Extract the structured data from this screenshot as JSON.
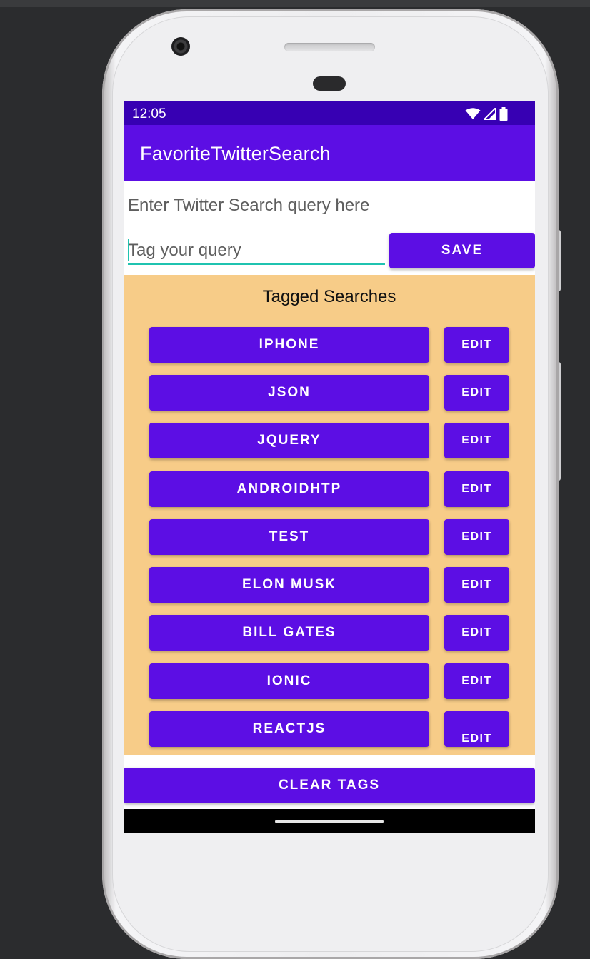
{
  "status_bar": {
    "time": "12:05",
    "icons": [
      "wifi-icon",
      "signal-icon",
      "battery-icon"
    ]
  },
  "app_bar": {
    "title": "FavoriteTwitterSearch"
  },
  "form": {
    "query_placeholder": "Enter Twitter Search query here",
    "query_value": "",
    "tag_placeholder": "Tag your query",
    "tag_value": "",
    "save_label": "SAVE"
  },
  "tagged": {
    "title": "Tagged Searches",
    "items": [
      {
        "label": "IPHONE",
        "edit": "EDIT"
      },
      {
        "label": "JSON",
        "edit": "EDIT"
      },
      {
        "label": "JQUERY",
        "edit": "EDIT"
      },
      {
        "label": "ANDROIDHTP",
        "edit": "EDIT"
      },
      {
        "label": "TEST",
        "edit": "EDIT"
      },
      {
        "label": "ELON MUSK",
        "edit": "EDIT"
      },
      {
        "label": "BILL GATES",
        "edit": "EDIT"
      },
      {
        "label": "IONIC",
        "edit": "EDIT"
      },
      {
        "label": "REACTJS",
        "edit": "EDIT"
      }
    ]
  },
  "clear_label": "CLEAR TAGS",
  "colors": {
    "primary": "#5c0ee4",
    "status_bar": "#3700b3",
    "panel": "#f7cc88",
    "accent": "#1fc3b0"
  }
}
